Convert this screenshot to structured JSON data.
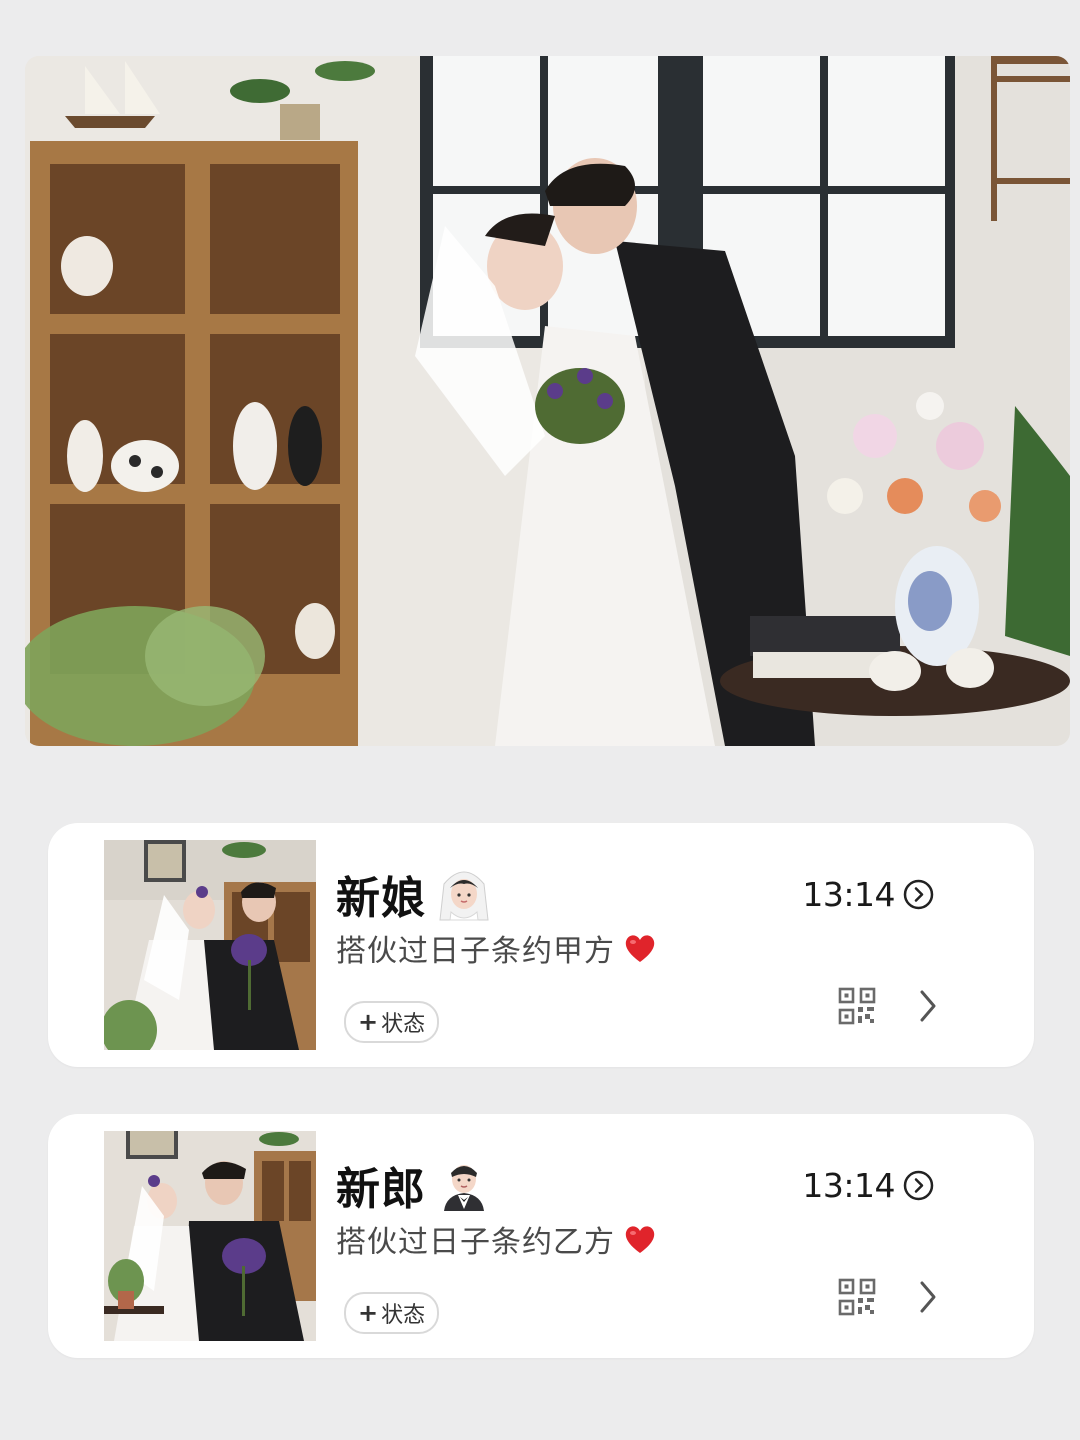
{
  "bride": {
    "name": "新娘",
    "avatar_emoji": "bride-with-veil-emoji",
    "signature": "搭伙过日子条约甲方",
    "signature_emoji": "red-heart-emoji",
    "time": "13:14",
    "status_button": {
      "plus": "+",
      "label": "状态"
    },
    "icons": [
      "clock-icon",
      "qr-code-icon",
      "chevron-right-icon"
    ]
  },
  "groom": {
    "name": "新郎",
    "avatar_emoji": "man-in-tuxedo-emoji",
    "signature": "搭伙过日子条约乙方",
    "signature_emoji": "red-heart-emoji",
    "time": "13:14",
    "status_button": {
      "plus": "+",
      "label": "状态"
    },
    "icons": [
      "clock-icon",
      "qr-code-icon",
      "chevron-right-icon"
    ]
  },
  "colors": {
    "page_background": "#ececed",
    "card_background": "#ffffff",
    "heart_red": "#e0242b",
    "text_primary": "#111111",
    "text_secondary": "#4a4a4a"
  }
}
